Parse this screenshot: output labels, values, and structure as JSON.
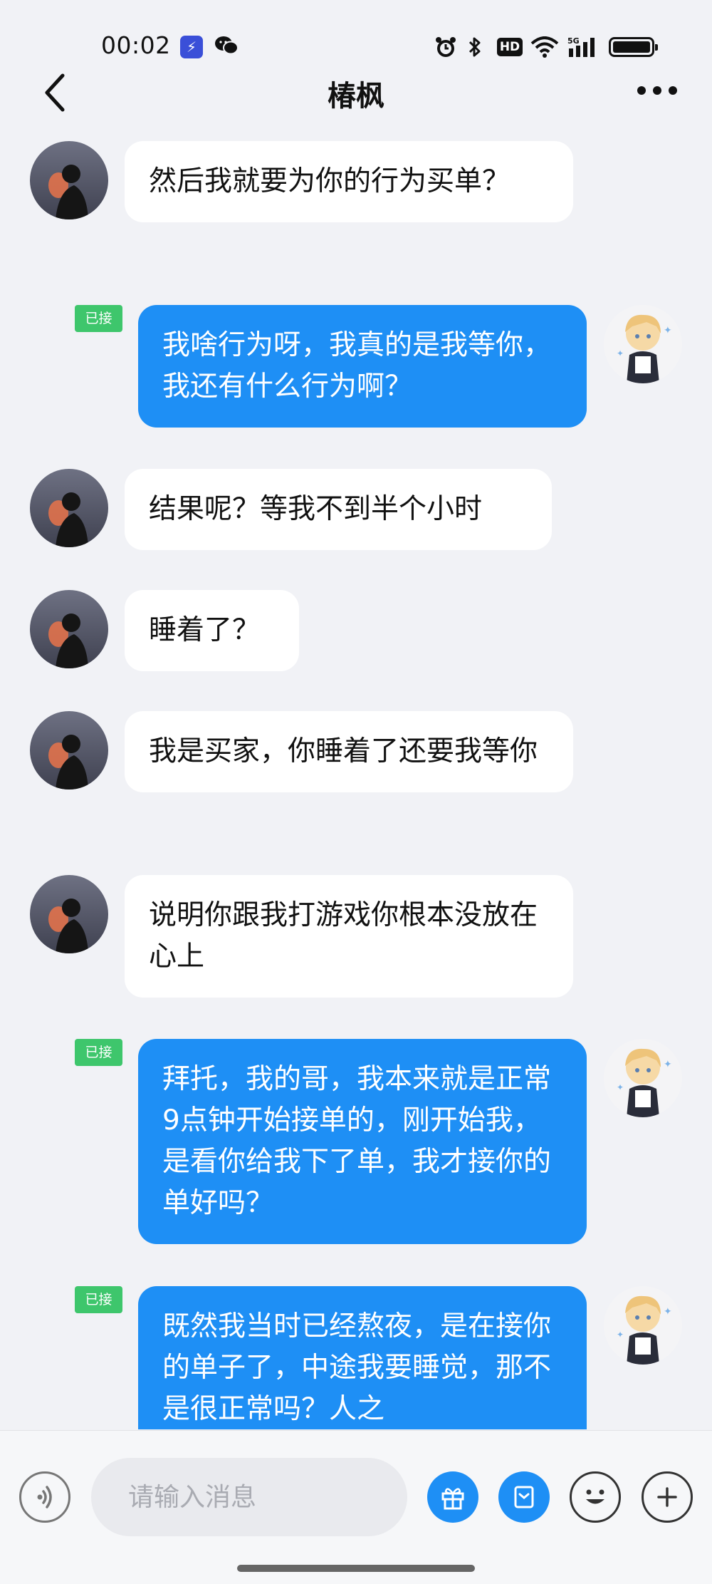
{
  "status_bar": {
    "time": "00:02"
  },
  "header": {
    "title": "椿枫"
  },
  "messages": [
    {
      "text": "然后我就要为你的行为买单？"
    },
    {
      "text": "我啥行为呀，我真的是我等你，我还有什么行为啊？",
      "badge": "已接"
    },
    {
      "text": "结果呢？等我不到半个小时"
    },
    {
      "text": "睡着了？"
    },
    {
      "text": "我是买家，你睡着了还要我等你"
    },
    {
      "text": "说明你跟我打游戏你根本没放在心上"
    },
    {
      "text": "拜托，我的哥，我本来就是正常9点钟开始接单的，刚开始我，是看你给我下了单，我才接你的单好吗？",
      "badge": "已接"
    },
    {
      "text": "既然我当时已经熬夜，是在接你的单子了，中途我要睡觉，那不是很正常吗？人之",
      "badge": "已接"
    }
  ],
  "input_bar": {
    "placeholder": "请输入消息"
  },
  "colors": {
    "accent": "#1e8ff5",
    "badge": "#3ec66c",
    "background": "#f1f2f6"
  }
}
